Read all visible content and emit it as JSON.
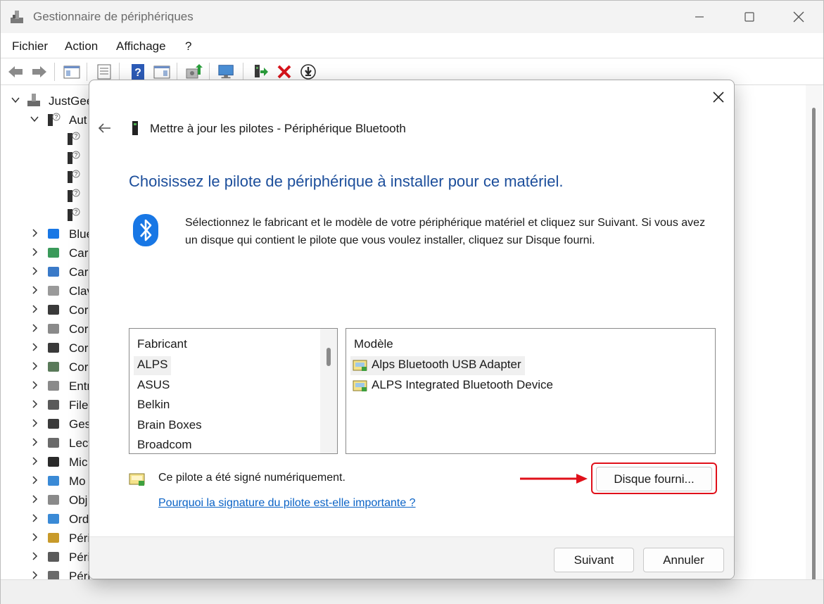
{
  "window": {
    "title": "Gestionnaire de périphériques",
    "menu": [
      "Fichier",
      "Action",
      "Affichage",
      "?"
    ]
  },
  "tree": {
    "root": "JustGee",
    "expanded_child": "Aut",
    "unknown_devices_count": 5,
    "categories": [
      "Blue",
      "Car",
      "Car",
      "Clav",
      "Cor",
      "Cor",
      "Cor",
      "Cor",
      "Entr",
      "File",
      "Ges",
      "Lect",
      "Mic",
      "Mo",
      "Obj",
      "Ord",
      "Péri",
      "Péri",
      "Péri"
    ]
  },
  "dialog": {
    "header": "Mettre à jour les pilotes - Périphérique Bluetooth",
    "heading": "Choisissez le pilote de périphérique à installer pour ce matériel.",
    "description": "Sélectionnez le fabricant et le modèle de votre périphérique matériel et cliquez sur Suivant. Si vous avez un disque qui contient le pilote que vous voulez installer, cliquez sur Disque fourni.",
    "manufacturer_header": "Fabricant",
    "manufacturers": [
      "ALPS",
      "ASUS",
      "Belkin",
      "Brain Boxes",
      "Broadcom"
    ],
    "selected_manufacturer_index": 0,
    "model_header": "Modèle",
    "models": [
      "Alps Bluetooth USB Adapter",
      "ALPS Integrated Bluetooth Device"
    ],
    "selected_model_index": 0,
    "signed_text": "Ce pilote a été signé numériquement.",
    "signature_link": "Pourquoi la signature du pilote est-elle importante ?",
    "have_disk_button": "Disque fourni...",
    "next_button": "Suivant",
    "cancel_button": "Annuler"
  },
  "colors": {
    "heading": "#1c4e9b",
    "link": "#0b63c6",
    "highlight": "#e0101a",
    "bluetooth": "#1877e5"
  }
}
